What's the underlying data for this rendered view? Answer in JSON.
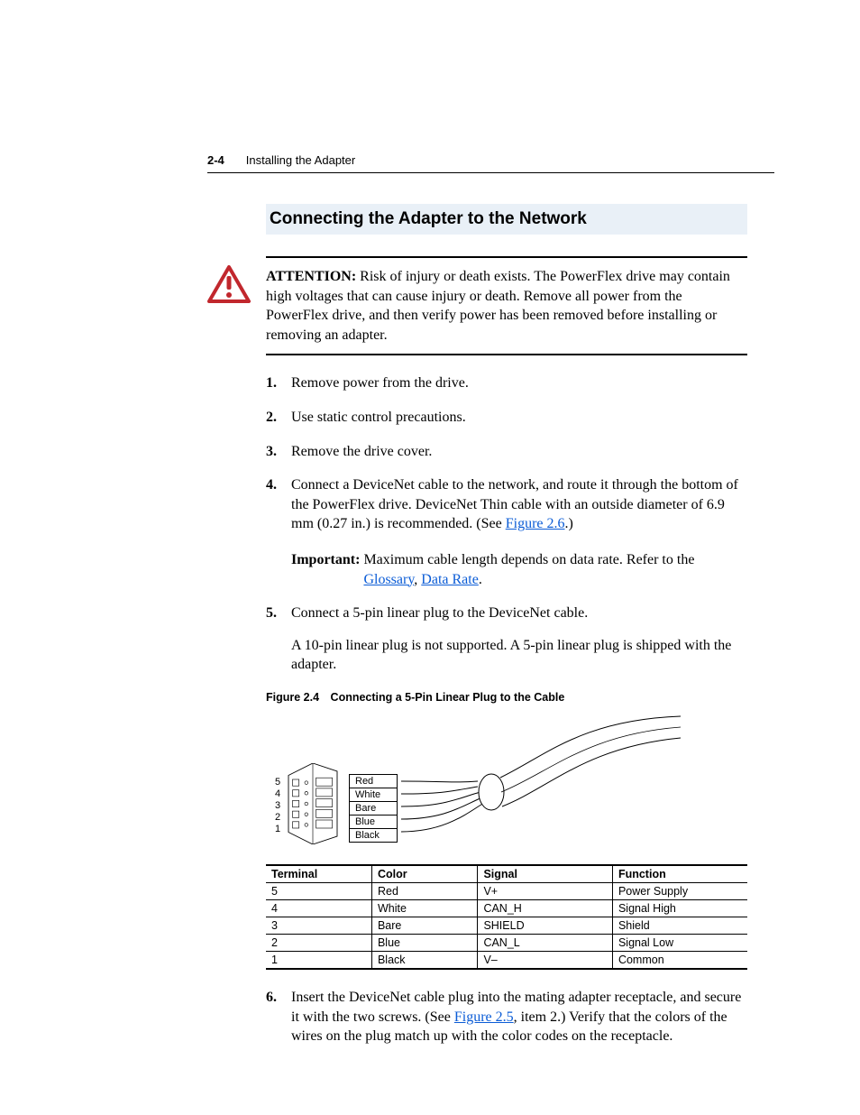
{
  "header": {
    "page_number": "2-4",
    "chapter_title": "Installing the Adapter"
  },
  "section_title": "Connecting the Adapter to the Network",
  "attention": {
    "label": "ATTENTION:",
    "text": "Risk of injury or death exists. The PowerFlex drive may contain high voltages that can cause injury or death. Remove all power from the PowerFlex drive, and then verify power has been removed before installing or removing an adapter."
  },
  "steps": {
    "1": "Remove power from the drive.",
    "2": "Use static control precautions.",
    "3": "Remove the drive cover.",
    "4_a": "Connect a DeviceNet cable to the network, and route it through the bottom of the PowerFlex drive. DeviceNet Thin cable with an outside diameter of 6.9 mm (0.27 in.) is recommended. (See ",
    "4_link": "Figure 2.6",
    "4_b": ".)",
    "4_important_label": "Important:",
    "4_important_a": "Maximum cable length depends on data rate. Refer to the ",
    "4_important_link1": "Glossary",
    "4_important_sep": ", ",
    "4_important_link2": "Data Rate",
    "4_important_b": ".",
    "5_a": "Connect a 5-pin linear plug to the DeviceNet cable.",
    "5_b": "A 10-pin linear plug is not supported. A 5-pin linear plug is shipped with the adapter.",
    "6_a": "Insert the DeviceNet cable plug into the mating adapter receptacle, and secure it with the two screws. (See ",
    "6_link": "Figure 2.5",
    "6_b": ", item 2.) Verify that the colors of the wires on the plug match up with the color codes on the receptacle."
  },
  "figure": {
    "caption": "Figure 2.4 Connecting a 5-Pin Linear Plug to the Cable",
    "pins": {
      "5": "5",
      "4": "4",
      "3": "3",
      "2": "2",
      "1": "1"
    },
    "wires": {
      "red": "Red",
      "white": "White",
      "bare": "Bare",
      "blue": "Blue",
      "black": "Black"
    }
  },
  "table": {
    "headers": {
      "terminal": "Terminal",
      "color": "Color",
      "signal": "Signal",
      "function": "Function"
    },
    "rows": [
      {
        "terminal": "5",
        "color": "Red",
        "signal": "V+",
        "function": "Power Supply"
      },
      {
        "terminal": "4",
        "color": "White",
        "signal": "CAN_H",
        "function": "Signal High"
      },
      {
        "terminal": "3",
        "color": "Bare",
        "signal": "SHIELD",
        "function": "Shield"
      },
      {
        "terminal": "2",
        "color": "Blue",
        "signal": "CAN_L",
        "function": "Signal Low"
      },
      {
        "terminal": "1",
        "color": "Black",
        "signal": "V–",
        "function": "Common"
      }
    ]
  }
}
